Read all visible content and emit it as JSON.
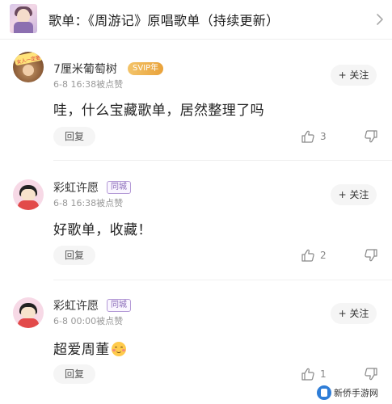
{
  "header": {
    "title": "歌单：《周游记》原唱歌单（持续更新）",
    "chevron_icon": "chevron-right-icon"
  },
  "comments": [
    {
      "username": "7厘米葡萄树",
      "badge": "SVIP年",
      "meta": "6-8 16:38被点赞",
      "follow_label": "+ 关注",
      "content": "哇，什么宝藏歌单，居然整理了吗",
      "reply_label": "回复",
      "like_count": "3",
      "avatar_text": "女人一定要HAPPY"
    },
    {
      "username": "彩虹许愿",
      "badge": "同城",
      "meta": "6-8 16:38被点赞",
      "follow_label": "+ 关注",
      "content": "好歌单，收藏！",
      "reply_label": "回复",
      "like_count": "2"
    },
    {
      "username": "彩虹许愿",
      "badge": "同城",
      "meta": "6-8 00:00被点赞",
      "follow_label": "+ 关注",
      "content": "超爱周董",
      "content_emoji": "smiling-blush-emoji",
      "reply_label": "回复",
      "like_count": "1"
    }
  ],
  "watermark": {
    "text": "新侨手游网"
  },
  "colors": {
    "svip_gold": "#e9a23a",
    "city_purple": "#8a6bb8",
    "muted_text": "#999999",
    "button_bg": "#f5f5f5"
  }
}
